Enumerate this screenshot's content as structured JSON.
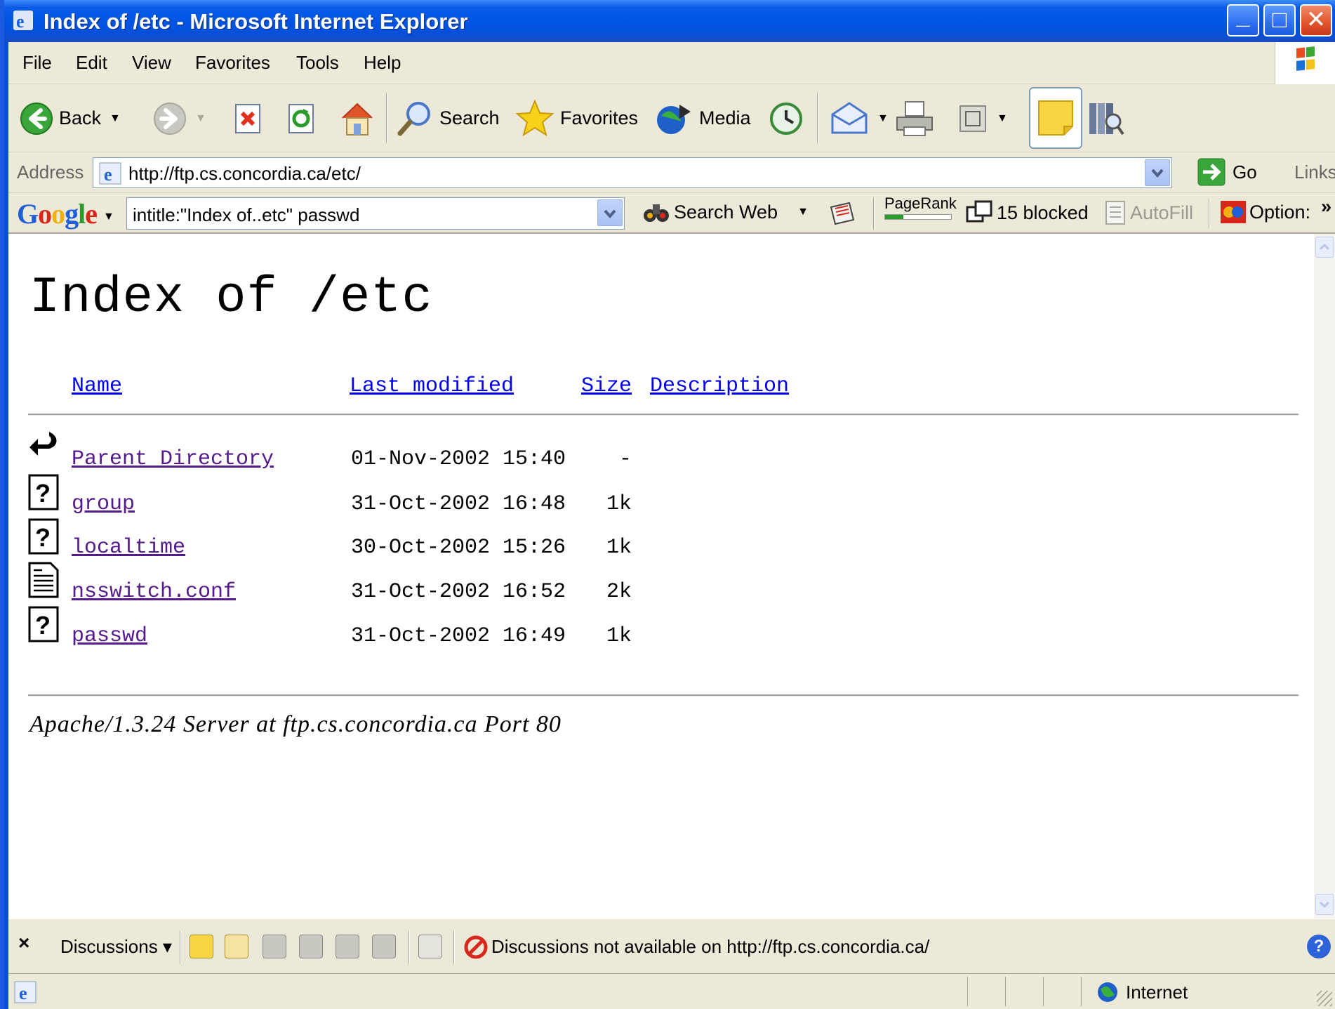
{
  "window": {
    "title": "Index of /etc - Microsoft Internet Explorer",
    "controls": {
      "minimize": "_",
      "maximize": "□",
      "close": "✕"
    }
  },
  "menu": [
    "File",
    "Edit",
    "View",
    "Favorites",
    "Tools",
    "Help"
  ],
  "toolbar": {
    "back": "Back",
    "search": "Search",
    "favorites": "Favorites",
    "media": "Media"
  },
  "address": {
    "label": "Address",
    "url": "http://ftp.cs.concordia.ca/etc/",
    "go": "Go",
    "links": "Links"
  },
  "google": {
    "logo": "Google",
    "query": "intitle:\"Index of..etc\" passwd",
    "search_web": "Search Web",
    "pagerank": "PageRank",
    "blocked": "15 blocked",
    "autofill": "AutoFill",
    "options": "Option:",
    "more": "»"
  },
  "page": {
    "title": "Index of /etc",
    "columns": [
      "Name",
      "Last modified",
      "Size",
      "Description"
    ],
    "rows": [
      {
        "name": "Parent Directory",
        "modified": "01-Nov-2002 15:40",
        "size": "-",
        "icon": "back-arrow-icon"
      },
      {
        "name": "group",
        "modified": "31-Oct-2002 16:48",
        "size": "1k",
        "icon": "unknown-file-icon"
      },
      {
        "name": "localtime",
        "modified": "30-Oct-2002 15:26",
        "size": "1k",
        "icon": "unknown-file-icon"
      },
      {
        "name": "nsswitch.conf",
        "modified": "31-Oct-2002 16:52",
        "size": "2k",
        "icon": "text-file-icon"
      },
      {
        "name": "passwd",
        "modified": "31-Oct-2002 16:49",
        "size": "1k",
        "icon": "unknown-file-icon"
      }
    ],
    "server_signature": "Apache/1.3.24 Server at ftp.cs.concordia.ca Port 80"
  },
  "discussions": {
    "close": "×",
    "label": "Discussions ▾",
    "message": "Discussions not available on http://ftp.cs.concordia.ca/",
    "help": "?"
  },
  "status": {
    "zone": "Internet"
  }
}
